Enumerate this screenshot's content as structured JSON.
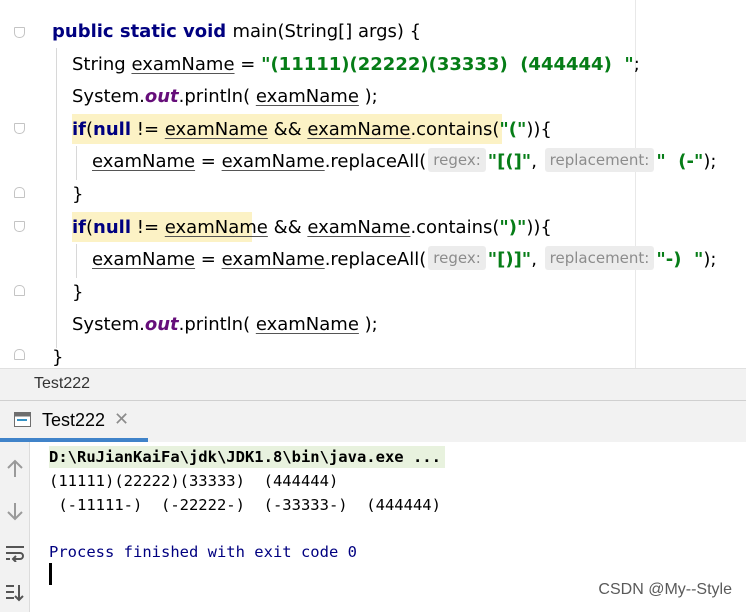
{
  "code_lines": [
    {
      "indent": 1,
      "tokens": [
        {
          "t": "public static void ",
          "c": "kw"
        },
        {
          "t": "main(String[] args) {",
          "c": ""
        }
      ]
    },
    {
      "indent": 2,
      "tokens": [
        {
          "t": "String ",
          "c": ""
        },
        {
          "t": "examName",
          "c": "ul"
        },
        {
          "t": " = ",
          "c": ""
        },
        {
          "t": "\"(11111)(22222)(33333)  (444444)  \"",
          "c": "str"
        },
        {
          "t": ";",
          "c": ""
        }
      ]
    },
    {
      "indent": 2,
      "tokens": [
        {
          "t": "System.",
          "c": ""
        },
        {
          "t": "out",
          "c": "fld"
        },
        {
          "t": ".println( ",
          "c": ""
        },
        {
          "t": "examName",
          "c": "ul"
        },
        {
          "t": " );",
          "c": ""
        }
      ]
    },
    {
      "indent": 2,
      "tokens": [
        {
          "t": "if",
          "c": "kw"
        },
        {
          "t": "(",
          "c": ""
        },
        {
          "t": "null",
          "c": "kw"
        },
        {
          "t": " != ",
          "c": ""
        },
        {
          "t": "examName",
          "c": "ul"
        },
        {
          "t": " && ",
          "c": ""
        },
        {
          "t": "examName",
          "c": "ul"
        },
        {
          "t": ".contains(",
          "c": ""
        },
        {
          "t": "\"(\"",
          "c": "str"
        },
        {
          "t": ")){",
          "c": ""
        }
      ]
    },
    {
      "indent": 3,
      "tokens": [
        {
          "t": "examName",
          "c": "ul"
        },
        {
          "t": " = ",
          "c": ""
        },
        {
          "t": "examName",
          "c": "ul"
        },
        {
          "t": ".replaceAll(",
          "c": ""
        },
        {
          "t": "regex:",
          "c": "hint"
        },
        {
          "t": "\"[(]\"",
          "c": "str"
        },
        {
          "t": ", ",
          "c": ""
        },
        {
          "t": "replacement:",
          "c": "hint"
        },
        {
          "t": "\"  (-\"",
          "c": "str"
        },
        {
          "t": ");",
          "c": ""
        }
      ]
    },
    {
      "indent": 2,
      "tokens": [
        {
          "t": "}",
          "c": ""
        }
      ]
    },
    {
      "indent": 2,
      "tokens": [
        {
          "t": "if",
          "c": "kw"
        },
        {
          "t": "(",
          "c": ""
        },
        {
          "t": "null",
          "c": "kw"
        },
        {
          "t": " != ",
          "c": ""
        },
        {
          "t": "examName",
          "c": "ul"
        },
        {
          "t": " && ",
          "c": ""
        },
        {
          "t": "examName",
          "c": "ul"
        },
        {
          "t": ".contains(",
          "c": ""
        },
        {
          "t": "\")\"",
          "c": "str"
        },
        {
          "t": ")){",
          "c": ""
        }
      ]
    },
    {
      "indent": 3,
      "tokens": [
        {
          "t": "examName",
          "c": "ul"
        },
        {
          "t": " = ",
          "c": ""
        },
        {
          "t": "examName",
          "c": "ul"
        },
        {
          "t": ".replaceAll(",
          "c": ""
        },
        {
          "t": "regex:",
          "c": "hint"
        },
        {
          "t": "\"[)]\"",
          "c": "str"
        },
        {
          "t": ", ",
          "c": ""
        },
        {
          "t": "replacement:",
          "c": "hint"
        },
        {
          "t": "\"-)  \"",
          "c": "str"
        },
        {
          "t": ");",
          "c": ""
        }
      ]
    },
    {
      "indent": 2,
      "tokens": [
        {
          "t": "}",
          "c": ""
        }
      ]
    },
    {
      "indent": 2,
      "tokens": [
        {
          "t": "System.",
          "c": ""
        },
        {
          "t": "out",
          "c": "fld"
        },
        {
          "t": ".println( ",
          "c": ""
        },
        {
          "t": "examName",
          "c": "ul"
        },
        {
          "t": " );",
          "c": ""
        }
      ]
    },
    {
      "indent": 1,
      "tokens": [
        {
          "t": "}",
          "c": ""
        }
      ]
    }
  ],
  "breadcrumb": {
    "label": "Test222"
  },
  "run_window": {
    "tab_label": "Test222",
    "close_icon": "close-icon",
    "toolbar_icons": [
      "arrow-up-icon",
      "arrow-down-icon",
      "soft-wrap-icon",
      "scroll-to-end-icon"
    ]
  },
  "console": {
    "command": "D:\\RuJianKaiFa\\jdk\\JDK1.8\\bin\\java.exe ...",
    "output_line_1": "(11111)(22222)(33333)  (444444)",
    "output_line_2": " (-11111-)  (-22222-)  (-33333-)  (444444)",
    "exit_message": "Process finished with exit code 0"
  },
  "watermark": "CSDN @My--Style",
  "colors": {
    "keyword": "#000080",
    "string": "#067d17",
    "static_field": "#660e7a",
    "highlight": "#fcf2c5",
    "tab_underline": "#4083c9"
  }
}
